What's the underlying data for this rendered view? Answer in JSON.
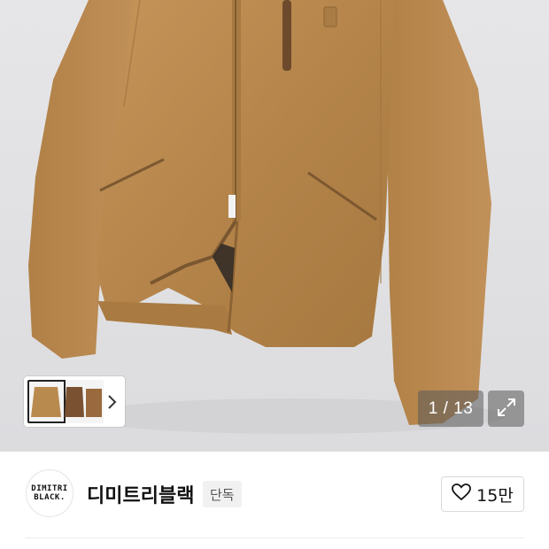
{
  "gallery": {
    "counter": "1 / 13",
    "next_icon": "chevron-right-icon",
    "expand_icon": "expand-icon"
  },
  "brand": {
    "logo_line1": "DIMITRI",
    "logo_line2": "BLACK.",
    "name": "디미트리블랙",
    "badge": "단독"
  },
  "like": {
    "icon": "heart-icon",
    "count": "15만"
  },
  "colors": {
    "suede": "#b98a4e",
    "suede_dark": "#8e6333",
    "background": "#e0e0e3"
  }
}
